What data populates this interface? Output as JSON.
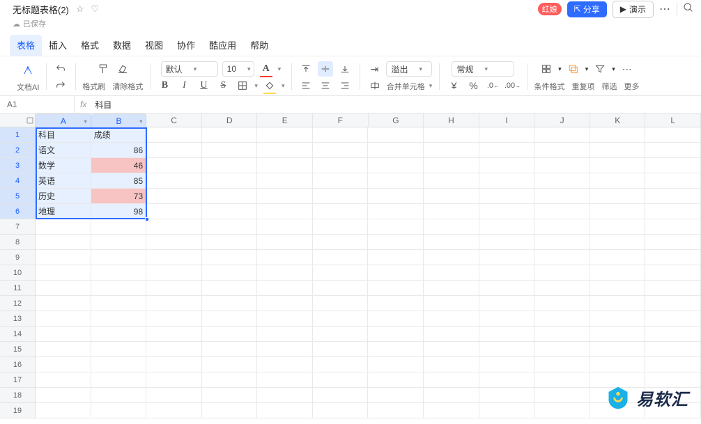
{
  "titlebar": {
    "doc_title": "无标题表格(2)",
    "saved_label": "已保存",
    "badge": "红娘",
    "share_label": "分享",
    "present_label": "演示"
  },
  "menu": {
    "items": [
      "表格",
      "插入",
      "格式",
      "数据",
      "视图",
      "协作",
      "酷应用",
      "帮助"
    ]
  },
  "toolbar": {
    "doc_ai": "文档AI",
    "brush": "格式刷",
    "clear": "清除格式",
    "font": "默认",
    "size": "10",
    "overflow": "溢出",
    "merge": "合并单元格",
    "num_format": "常规",
    "cond_fmt": "条件格式",
    "dup": "重复项",
    "filter": "筛选",
    "more": "更多"
  },
  "formula_bar": {
    "name": "A1",
    "fx": "fx",
    "content": "科目"
  },
  "columns": [
    "A",
    "B",
    "C",
    "D",
    "E",
    "F",
    "G",
    "H",
    "I",
    "J",
    "K",
    "L"
  ],
  "selectedCols": [
    "A",
    "B"
  ],
  "rows": 19,
  "selectedRows": [
    1,
    2,
    3,
    4,
    5,
    6
  ],
  "data": {
    "headers": [
      "科目",
      "成绩"
    ],
    "rows": [
      {
        "label": "语文",
        "val": "86",
        "hl": false
      },
      {
        "label": "数学",
        "val": "46",
        "hl": true
      },
      {
        "label": "英语",
        "val": "85",
        "hl": false
      },
      {
        "label": "历史",
        "val": "73",
        "hl": true
      },
      {
        "label": "地理",
        "val": "98",
        "hl": false
      }
    ]
  },
  "logo": "易软汇"
}
